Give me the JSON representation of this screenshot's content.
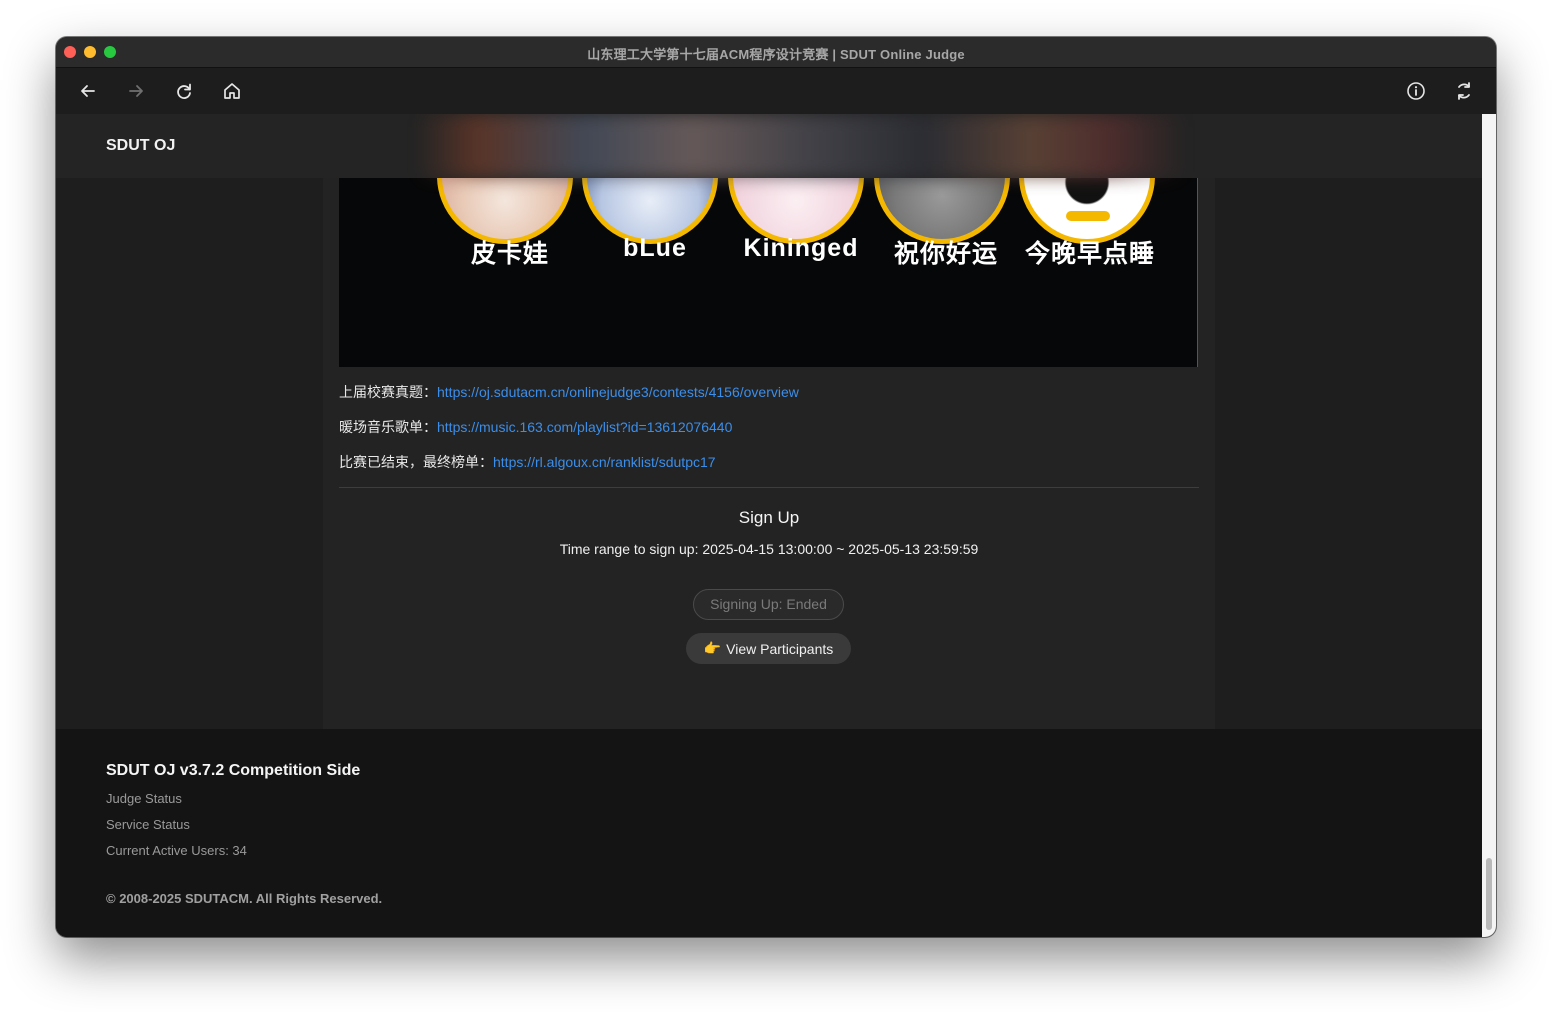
{
  "window": {
    "title": "山东理工大学第十七届ACM程序设计竞赛 | SDUT Online Judge"
  },
  "toolbar": {
    "icons": [
      "back-arrow-icon",
      "forward-arrow-icon",
      "reload-icon",
      "home-icon",
      "info-icon",
      "sync-icon"
    ]
  },
  "navbar": {
    "brand": "SDUT OJ"
  },
  "banner": {
    "names": [
      "皮卡娃",
      "bLue",
      "Kininged",
      "祝你好运",
      "今晚早点睡"
    ]
  },
  "info": {
    "last_contest_label": "上届校赛真题：",
    "last_contest_url": "https://oj.sdutacm.cn/onlinejudge3/contests/4156/overview",
    "music_label": "暖场音乐歌单：",
    "music_url": "https://music.163.com/playlist?id=13612076440",
    "ranklist_label": "比赛已结束，最终榜单：",
    "ranklist_url": "https://rl.algoux.cn/ranklist/sdutpc17"
  },
  "signup": {
    "title": "Sign Up",
    "time_range": "Time range to sign up: 2025-04-15 13:00:00 ~ 2025-05-13 23:59:59",
    "status_button": "Signing Up: Ended",
    "view_button_emoji": "👉",
    "view_button": "View Participants"
  },
  "footer": {
    "title": "SDUT OJ v3.7.2 Competition Side",
    "judge_status": "Judge Status",
    "service_status": "Service Status",
    "active_users": "Current Active Users: 34",
    "copyright": "© 2008-2025 SDUTACM. All Rights Reserved."
  },
  "colors": {
    "accent_link": "#3b8eea",
    "avatar_ring": "#f5b800",
    "background": "#202020"
  }
}
